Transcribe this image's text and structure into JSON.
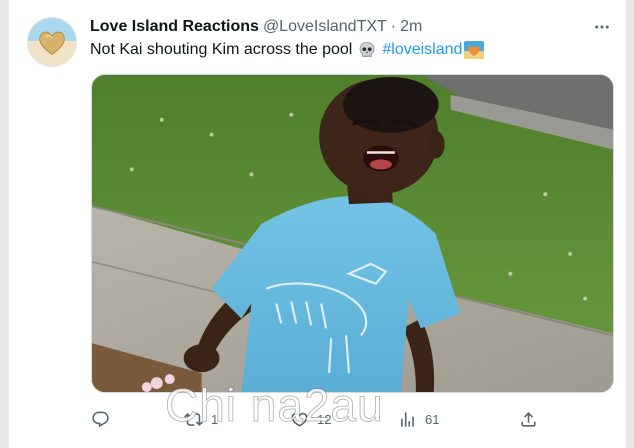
{
  "tweet": {
    "display_name": "Love Island Reactions",
    "handle": "@LoveIslandTXT",
    "separator": "·",
    "time": "2m",
    "text": "Not Kai shouting Kim across the pool",
    "skull_emoji": "skull-emoji",
    "hashtag": "#loveisland",
    "hashtag_emoji": "love-island-hashflag"
  },
  "media": {
    "description_icon": "meme-photo"
  },
  "actions": {
    "reply_count": "",
    "retweet_count": "1",
    "like_count": "12",
    "views_count": "61",
    "share_count": ""
  },
  "watermark": {
    "text": "Chi na2au"
  },
  "colors": {
    "accent": "#1d9bf0",
    "secondary_text": "#536471",
    "primary_text": "#0f1419",
    "background": "#ffffff"
  }
}
